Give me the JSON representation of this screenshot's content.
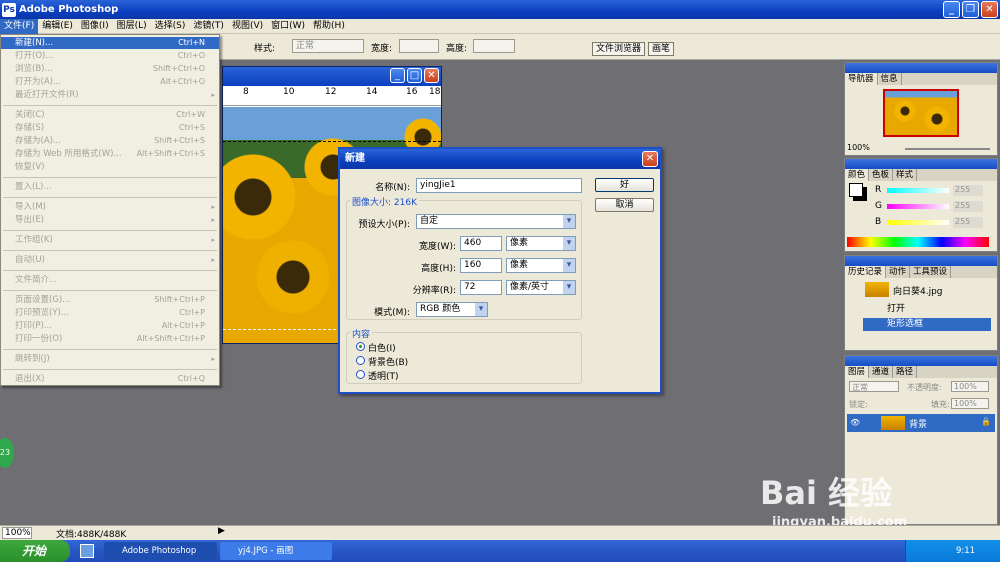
{
  "app": {
    "title": "Adobe Photoshop"
  },
  "menubar": [
    "文件(F)",
    "编辑(E)",
    "图像(I)",
    "图层(L)",
    "选择(S)",
    "滤镜(T)",
    "视图(V)",
    "窗口(W)",
    "帮助(H)"
  ],
  "optbar": {
    "style_label": "样式:",
    "style_value": "正常",
    "width_label": "宽度:",
    "height_label": "高度:",
    "file_browser_tab": "文件浏览器",
    "brush_tab": "画笔"
  },
  "filemenu": [
    {
      "label": "新建(N)...",
      "sc": "Ctrl+N",
      "hl": true
    },
    {
      "label": "打开(O)...",
      "sc": "Ctrl+O"
    },
    {
      "label": "浏览(B)...",
      "sc": "Shift+Ctrl+O"
    },
    {
      "label": "打开为(A)...",
      "sc": "Alt+Ctrl+O"
    },
    {
      "label": "最近打开文件(R)",
      "arr": "▸"
    },
    {
      "sep": true
    },
    {
      "label": "关闭(C)",
      "sc": "Ctrl+W"
    },
    {
      "label": "存储(S)",
      "sc": "Ctrl+S"
    },
    {
      "label": "存储为(A)...",
      "sc": "Shift+Ctrl+S"
    },
    {
      "label": "存储为 Web 所用格式(W)...",
      "sc": "Alt+Shift+Ctrl+S"
    },
    {
      "label": "恢复(V)"
    },
    {
      "sep": true
    },
    {
      "label": "置入(L)..."
    },
    {
      "sep": true
    },
    {
      "label": "导入(M)",
      "arr": "▸"
    },
    {
      "label": "导出(E)",
      "arr": "▸"
    },
    {
      "sep": true
    },
    {
      "label": "工作组(K)",
      "arr": "▸"
    },
    {
      "sep": true
    },
    {
      "label": "自动(U)",
      "arr": "▸"
    },
    {
      "sep": true
    },
    {
      "label": "文件简介..."
    },
    {
      "sep": true
    },
    {
      "label": "页面设置(G)...",
      "sc": "Shift+Ctrl+P"
    },
    {
      "label": "打印预览(Y)...",
      "sc": "Ctrl+P"
    },
    {
      "label": "打印(P)...",
      "sc": "Alt+Ctrl+P"
    },
    {
      "label": "打印一份(O)",
      "sc": "Alt+Shift+Ctrl+P"
    },
    {
      "sep": true
    },
    {
      "label": "跳转到(J)",
      "arr": "▸"
    },
    {
      "sep": true
    },
    {
      "label": "退出(X)",
      "sc": "Ctrl+Q"
    }
  ],
  "ruler": [
    "8",
    "10",
    "12",
    "14",
    "16",
    "18"
  ],
  "dialog": {
    "title": "新建",
    "name_label": "名称(N):",
    "name_value": "yingJie1",
    "ok": "好",
    "cancel": "取消",
    "image_size": "图像大小: 216K",
    "preset_label": "预设大小(P):",
    "preset_value": "自定",
    "width_label": "宽度(W):",
    "width_value": "460",
    "width_unit": "像素",
    "height_label": "高度(H):",
    "height_value": "160",
    "height_unit": "像素",
    "res_label": "分辨率(R):",
    "res_value": "72",
    "res_unit": "像素/英寸",
    "mode_label": "模式(M):",
    "mode_value": "RGB 颜色",
    "content_label": "内容",
    "opt_white": "白色(I)",
    "opt_bg": "背景色(B)",
    "opt_trans": "透明(T)"
  },
  "navigator": {
    "tabs": [
      "导航器",
      "信息"
    ],
    "zoom": "100%"
  },
  "color": {
    "tabs": [
      "颜色",
      "色板",
      "样式"
    ],
    "r": "255",
    "g": "255",
    "b": "255",
    "r_label": "R",
    "g_label": "G",
    "b_label": "B"
  },
  "history": {
    "tabs": [
      "历史记录",
      "动作",
      "工具预设"
    ],
    "snapshot": "向日葵4.jpg",
    "items": [
      "打开",
      "矩形选框"
    ]
  },
  "layers": {
    "tabs": [
      "图层",
      "通道",
      "路径"
    ],
    "blend": "正常",
    "opacity_label": "不透明度:",
    "opacity": "100%",
    "lock_label": "锁定:",
    "fill_label": "填充:",
    "fill": "100%",
    "layer_name": "背景"
  },
  "status": {
    "zoom": "100%",
    "doc": "文档:488K/488K"
  },
  "taskbar": {
    "start": "开始",
    "btn1": "Adobe Photoshop",
    "btn2": "yj4.JPG - 画图",
    "time": "9:11"
  },
  "badge": "23",
  "watermark": {
    "brand": "Bai 经验",
    "url": "jingyan.baidu.com"
  },
  "colors": {
    "titlebar": "#0b3fbf",
    "highlight": "#316ac5",
    "canvas": "#6f6e73"
  }
}
